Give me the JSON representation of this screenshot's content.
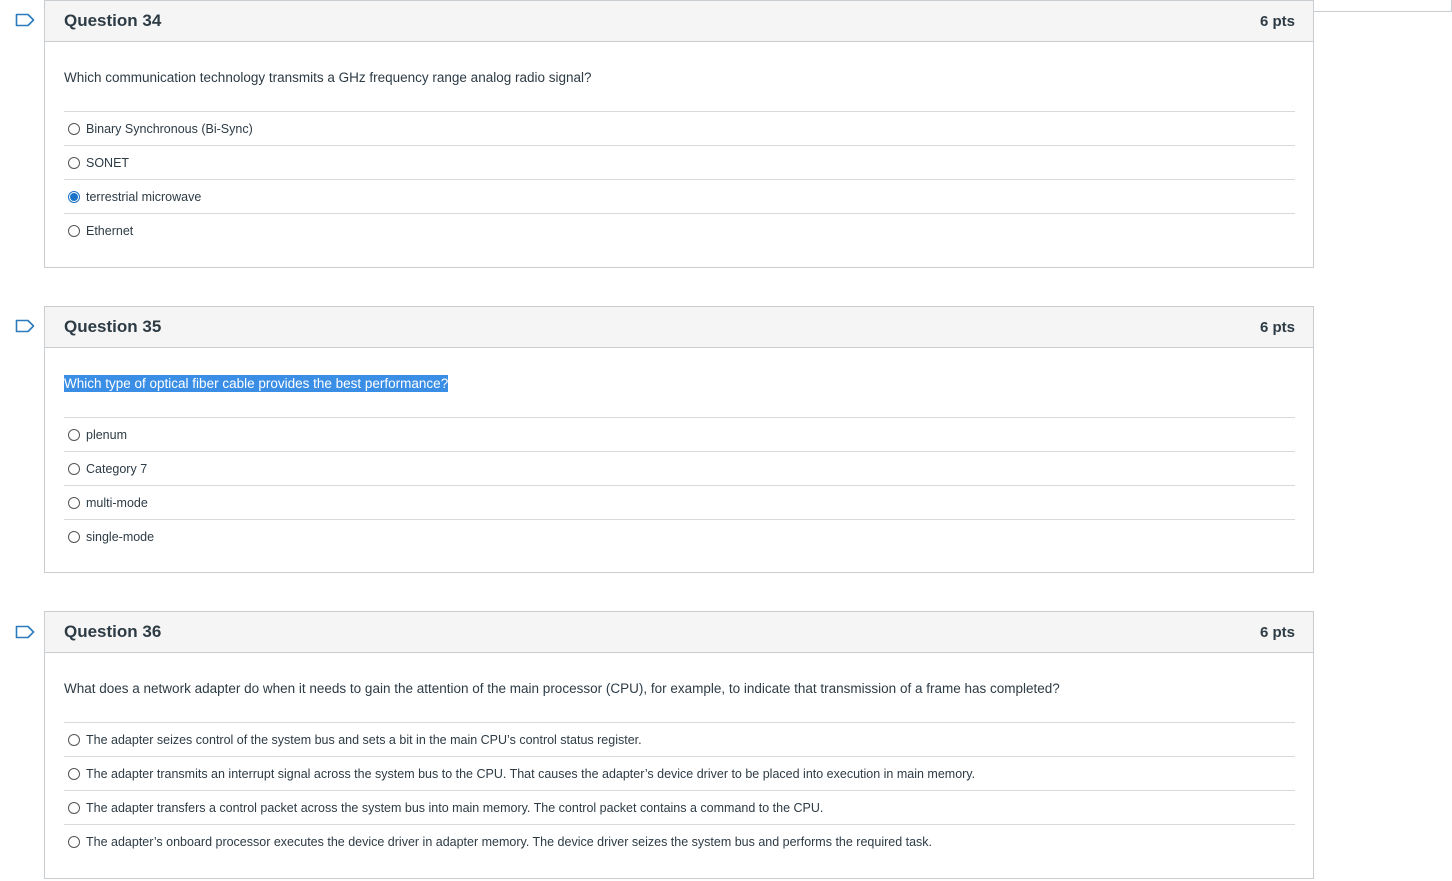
{
  "questions": [
    {
      "title": "Question 34",
      "points": "6 pts",
      "prompt": "Which communication technology transmits a GHz frequency range analog radio signal?",
      "highlighted": false,
      "answers": [
        {
          "label": "Binary Synchronous (Bi-Sync)",
          "selected": false
        },
        {
          "label": "SONET",
          "selected": false
        },
        {
          "label": "terrestrial microwave",
          "selected": true
        },
        {
          "label": "Ethernet",
          "selected": false
        }
      ]
    },
    {
      "title": "Question 35",
      "points": "6 pts",
      "prompt": "Which type of optical fiber cable provides the best performance?",
      "highlighted": true,
      "answers": [
        {
          "label": "plenum",
          "selected": false
        },
        {
          "label": "Category 7",
          "selected": false
        },
        {
          "label": "multi-mode",
          "selected": false
        },
        {
          "label": "single-mode",
          "selected": false
        }
      ]
    },
    {
      "title": "Question 36",
      "points": "6 pts",
      "prompt": "What does a network adapter do when it needs to gain the attention of the main processor (CPU), for example, to indicate that transmission of a frame has completed?",
      "highlighted": false,
      "answers": [
        {
          "label": "The adapter seizes control of the system bus and sets a bit in the main CPU’s control status register.",
          "selected": false
        },
        {
          "label": "The adapter transmits an interrupt signal across the system bus to the CPU. That causes the adapter’s device driver to be placed into execution in main memory.",
          "selected": false
        },
        {
          "label": "The adapter transfers a control packet across the system bus into main memory. The control packet contains a command to the CPU.",
          "selected": false
        },
        {
          "label": "The adapter’s onboard processor executes the device driver in adapter memory. The device driver seizes the system bus and performs the required task.",
          "selected": false
        }
      ]
    }
  ],
  "colors": {
    "accent": "#1a73c9",
    "highlight": "#3a8ee6",
    "header_bg": "#f5f5f5",
    "border": "#c7cdd1"
  },
  "icons": {
    "flag": "flag-icon",
    "radio": "radio-button"
  }
}
